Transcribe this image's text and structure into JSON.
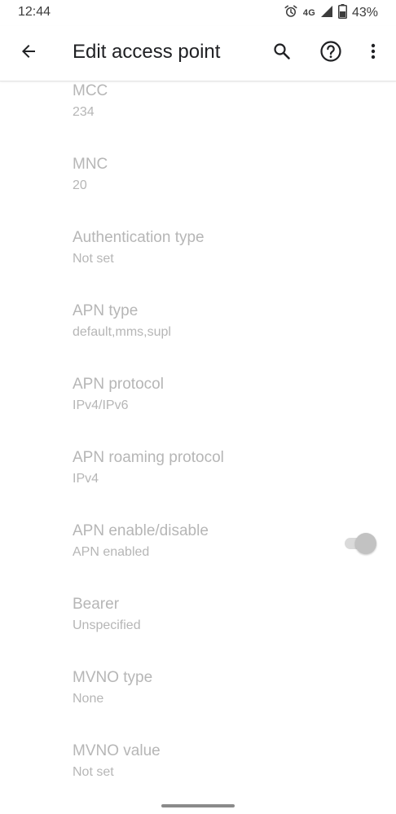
{
  "status_bar": {
    "time": "12:44",
    "network": "4G",
    "battery": "43%",
    "icons": [
      "alarm-icon",
      "signal-icon",
      "battery-icon"
    ]
  },
  "app_bar": {
    "title": "Edit access point",
    "icons": [
      "back-arrow-icon",
      "search-icon",
      "help-icon",
      "more-vert-icon"
    ]
  },
  "settings": [
    {
      "title": "MCC",
      "summary": "234"
    },
    {
      "title": "MNC",
      "summary": "20"
    },
    {
      "title": "Authentication type",
      "summary": "Not set"
    },
    {
      "title": "APN type",
      "summary": "default,mms,supl"
    },
    {
      "title": "APN protocol",
      "summary": "IPv4/IPv6"
    },
    {
      "title": "APN roaming protocol",
      "summary": "IPv4"
    },
    {
      "title": "APN enable/disable",
      "summary": "APN enabled",
      "toggle_on": true
    },
    {
      "title": "Bearer",
      "summary": "Unspecified"
    },
    {
      "title": "MVNO type",
      "summary": "None"
    },
    {
      "title": "MVNO value",
      "summary": "Not set"
    }
  ],
  "colors": {
    "disabled_text": "#b6b6b6",
    "title_text": "#202124",
    "divider": "#e3e3e3"
  }
}
